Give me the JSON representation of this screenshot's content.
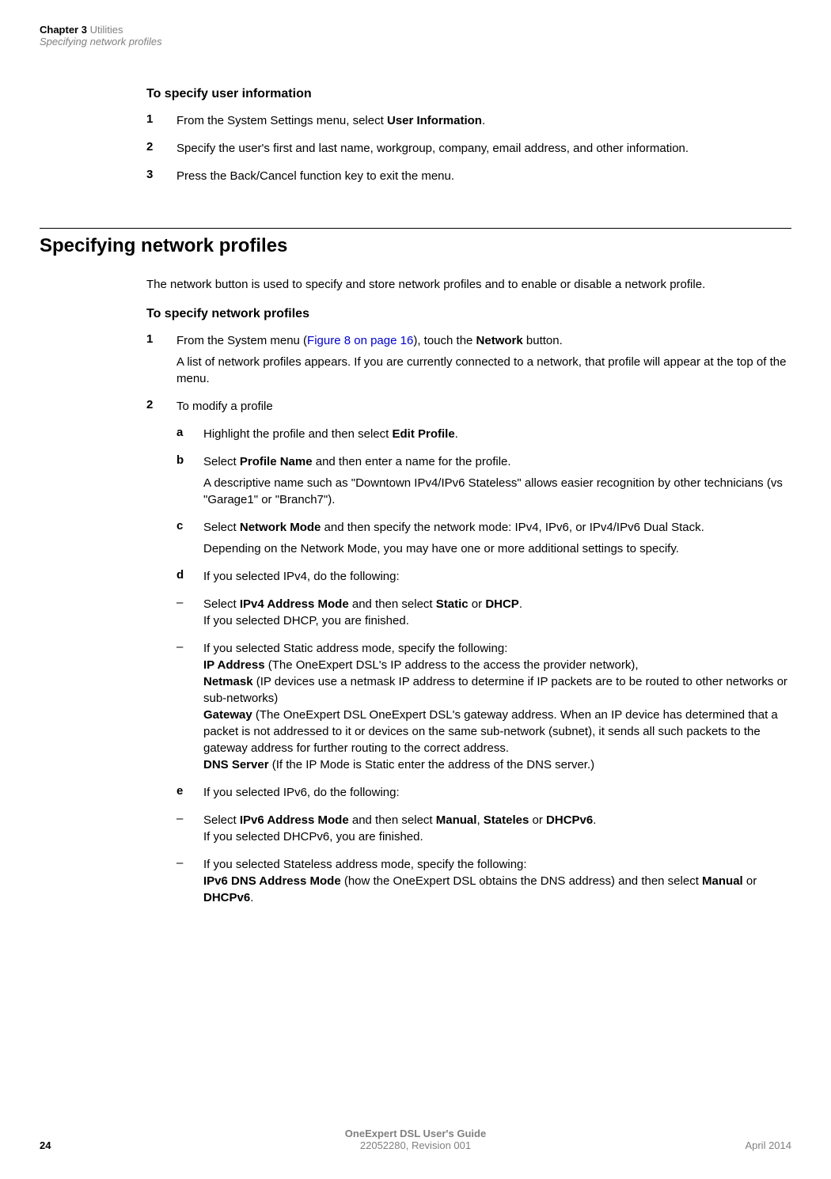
{
  "header": {
    "chapter_bold": "Chapter 3",
    "chapter_gray": "Utilities",
    "subtitle": "Specifying network profiles"
  },
  "section1": {
    "title": "To specify user information",
    "items": {
      "1": {
        "num": "1",
        "text_pre": "From the System Settings menu, select ",
        "text_bold": "User Information",
        "text_post": "."
      },
      "2": {
        "num": "2",
        "text": "Specify the user's first and last name, workgroup, company, email address, and other information."
      },
      "3": {
        "num": "3",
        "text": "Press the Back/Cancel function key to exit the menu."
      }
    }
  },
  "heading": "Specifying network profiles",
  "intro": "The network button is used to specify and store network profiles and to enable or disable a network profile.",
  "section2": {
    "title": "To specify network profiles",
    "item1": {
      "num": "1",
      "text_pre": "From the System menu (",
      "link": "Figure 8 on page 16",
      "text_mid": "), touch the ",
      "text_bold": "Network",
      "text_post": " button.",
      "sub": "A list of network profiles appears. If you are currently connected to a network, that profile will appear at the top of the menu."
    },
    "item2": {
      "num": "2",
      "text": "To modify a profile"
    },
    "sub_a": {
      "letter": "a",
      "pre": "Highlight the profile and then select ",
      "bold": "Edit Profile",
      "post": "."
    },
    "sub_b": {
      "letter": "b",
      "pre": "Select ",
      "bold": "Profile Name",
      "post": " and then enter a name for the profile.",
      "sub": "A descriptive name such as \"Downtown IPv4/IPv6 Stateless\" allows easier recognition by other technicians (vs \"Garage1\" or \"Branch7\")."
    },
    "sub_c": {
      "letter": "c",
      "pre": "Select ",
      "bold": "Network Mode",
      "post": " and then specify the network mode: IPv4, IPv6, or IPv4/IPv6 Dual Stack.",
      "sub": "Depending on the Network Mode, you may have one or more additional settings to specify."
    },
    "sub_d": {
      "letter": "d",
      "text": "If you selected IPv4, do the following:"
    },
    "dash_d1": {
      "dash": "–",
      "pre": "Select ",
      "bold1": "IPv4 Address Mode",
      "mid1": " and then select ",
      "bold2": "Static",
      "mid2": " or ",
      "bold3": "DHCP",
      "post": ".",
      "line2": "If you selected DHCP, you are finished."
    },
    "dash_d2": {
      "dash": "–",
      "line1": "If you selected Static address mode, specify the following:",
      "bold_ip": "IP Address",
      "text_ip": " (The OneExpert DSL's IP address to the access the provider network),",
      "bold_nm": "Netmask",
      "text_nm": " (IP devices use a netmask IP address to determine if IP packets are to be routed to other networks or sub-networks)",
      "bold_gw": "Gateway",
      "text_gw": " (The OneExpert DSL OneExpert DSL's gateway address. When an IP device has determined that a packet is not addressed to it or devices on the same sub-network (subnet), it sends all such packets to the gateway address for further routing to the correct address.",
      "bold_dns": "DNS Server",
      "text_dns": " (If the IP Mode is Static enter the address of the DNS server.)"
    },
    "sub_e": {
      "letter": "e",
      "text": "If you selected IPv6, do the following:"
    },
    "dash_e1": {
      "dash": "–",
      "pre": "Select ",
      "bold1": "IPv6 Address Mode",
      "mid1": " and then select ",
      "bold2": "Manual",
      "mid2": ", ",
      "bold3": "Stateles",
      "mid3": " or ",
      "bold4": "DHCPv6",
      "post": ".",
      "line2": "If you selected DHCPv6, you are finished."
    },
    "dash_e2": {
      "dash": "–",
      "line1": "If you selected Stateless address mode, specify the following:",
      "bold1": "IPv6 DNS Address Mode",
      "mid": " (how the OneExpert DSL obtains the DNS address) and then select ",
      "bold2": "Manual",
      "mid2": " or ",
      "bold3": "DHCPv6",
      "post": "."
    }
  },
  "footer": {
    "page": "24",
    "guide": "OneExpert DSL User's Guide",
    "rev": "22052280, Revision 001",
    "date": "April 2014"
  }
}
